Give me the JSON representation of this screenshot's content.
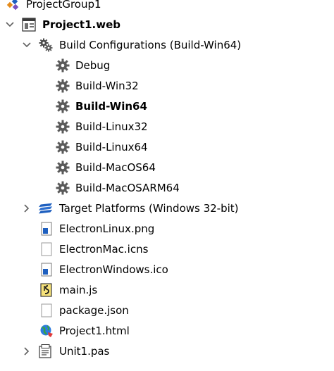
{
  "tree": {
    "group": {
      "label": "ProjectGroup1",
      "icon": "project-group-icon"
    },
    "project": {
      "label": "Project1.web",
      "icon": "web-project-icon",
      "expanded": true
    },
    "build_configs": {
      "label": "Build Configurations (Build-Win64)",
      "icon": "build-configurations-icon",
      "expanded": true,
      "items": [
        {
          "label": "Debug",
          "icon": "gear-icon",
          "active": false
        },
        {
          "label": "Build-Win32",
          "icon": "gear-icon",
          "active": false
        },
        {
          "label": "Build-Win64",
          "icon": "gear-icon",
          "active": true
        },
        {
          "label": "Build-Linux32",
          "icon": "gear-icon",
          "active": false
        },
        {
          "label": "Build-Linux64",
          "icon": "gear-icon",
          "active": false
        },
        {
          "label": "Build-MacOS64",
          "icon": "gear-icon",
          "active": false
        },
        {
          "label": "Build-MacOSARM64",
          "icon": "gear-icon",
          "active": false
        }
      ]
    },
    "target_platforms": {
      "label": "Target Platforms (Windows 32-bit)",
      "icon": "target-platforms-icon",
      "expanded": false
    },
    "files": [
      {
        "label": "ElectronLinux.png",
        "icon": "image-file-icon"
      },
      {
        "label": "ElectronMac.icns",
        "icon": "blank-file-icon"
      },
      {
        "label": "ElectronWindows.ico",
        "icon": "image-file-icon"
      },
      {
        "label": "main.js",
        "icon": "script-file-icon"
      },
      {
        "label": "package.json",
        "icon": "blank-file-icon"
      },
      {
        "label": "Project1.html",
        "icon": "html-file-icon"
      }
    ],
    "unit": {
      "label": "Unit1.pas",
      "icon": "pascal-unit-icon",
      "expanded": false
    }
  },
  "colors": {
    "text": "#000000",
    "expander": "#606060",
    "gear": "#5a5a5a",
    "accent_blue": "#1e5fbf",
    "accent_orange": "#e58b1b"
  }
}
